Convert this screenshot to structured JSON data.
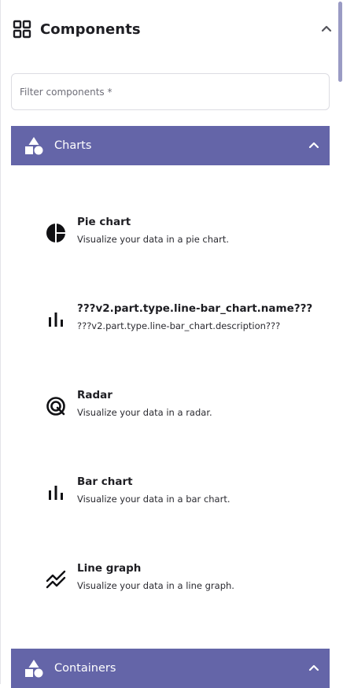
{
  "header": {
    "title": "Components",
    "icon": "grid-icon",
    "collapse_icon": "chevron-up-icon"
  },
  "filter": {
    "placeholder": "Filter components *",
    "value": ""
  },
  "colors": {
    "section_bg": "#6465a8",
    "section_text": "#ffffff",
    "scrollbar": "#9a9bc4"
  },
  "sections": [
    {
      "label": "Charts",
      "icon": "shapes-icon",
      "expanded": true,
      "items": [
        {
          "name": "Pie chart",
          "description": "Visualize your data in a pie chart.",
          "icon": "pie-chart-icon"
        },
        {
          "name": "???v2.part.type.line-bar_chart.name???",
          "description": "???v2.part.type.line-bar_chart.description???",
          "icon": "bar-chart-icon"
        },
        {
          "name": "Radar",
          "description": "Visualize your data in a radar.",
          "icon": "radar-icon"
        },
        {
          "name": "Bar chart",
          "description": "Visualize your data in a bar chart.",
          "icon": "bar-chart-icon"
        },
        {
          "name": "Line graph",
          "description": "Visualize your data in a line graph.",
          "icon": "line-graph-icon"
        }
      ]
    },
    {
      "label": "Containers",
      "icon": "shapes-icon",
      "expanded": true
    }
  ]
}
